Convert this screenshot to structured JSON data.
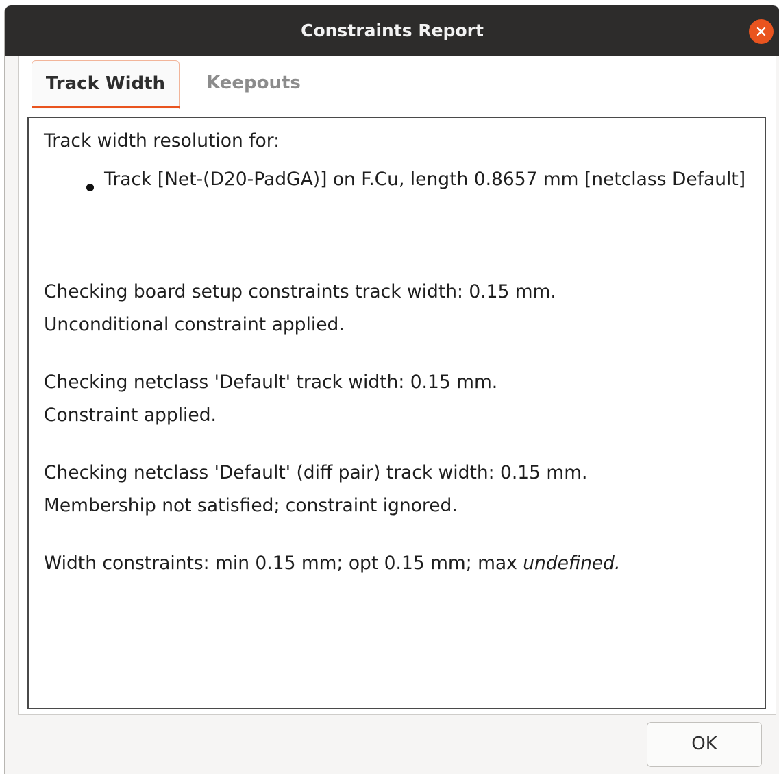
{
  "window": {
    "title": "Constraints Report"
  },
  "tabs": [
    {
      "label": "Track Width",
      "active": true
    },
    {
      "label": "Keepouts",
      "active": false
    }
  ],
  "report": {
    "heading": "Track width resolution for:",
    "item": "Track [Net-(D20-PadGA)] on F.Cu, length 0.8657 mm [netclass Default]",
    "lines": [
      "Checking board setup constraints track width: 0.15 mm.",
      "Unconditional constraint applied.",
      "Checking netclass 'Default' track width: 0.15 mm.",
      "Constraint applied.",
      "Checking netclass 'Default' (diff pair) track width: 0.15 mm.",
      "Membership not satisfied; constraint ignored."
    ],
    "summary": {
      "prefix": "Width constraints: min 0.15 mm; opt 0.15 mm; max ",
      "emphasis": "undefined."
    }
  },
  "buttons": {
    "ok_label": "OK"
  },
  "icons": {
    "close": "close-icon"
  },
  "colors": {
    "accent": "#e9541f",
    "titlebar": "#2d2c2b"
  }
}
